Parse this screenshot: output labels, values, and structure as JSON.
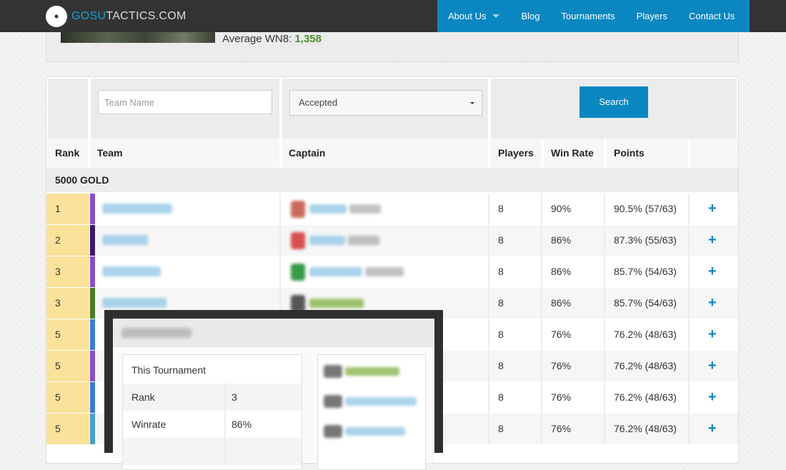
{
  "site": {
    "logo_accent": "GOSU",
    "logo_rest": "TACTICS.COM"
  },
  "nav": {
    "items": [
      {
        "label": "About Us",
        "has_dropdown": true
      },
      {
        "label": "Blog"
      },
      {
        "label": "Tournaments"
      },
      {
        "label": "Players"
      },
      {
        "label": "Contact Us"
      }
    ]
  },
  "summary": {
    "avg_wn8_label": "Average WN8:",
    "avg_wn8_value": "1,358"
  },
  "filters": {
    "team_placeholder": "Team Name",
    "status_value": "Accepted",
    "search_label": "Search"
  },
  "table": {
    "columns": {
      "rank": "Rank",
      "team": "Team",
      "captain": "Captain",
      "players": "Players",
      "win_rate": "Win Rate",
      "points": "Points"
    },
    "group_label": "5000 GOLD",
    "rows": [
      {
        "rank": "1",
        "players": "8",
        "win_rate": "90%",
        "points": "90.5% (57/63)",
        "plus": "+",
        "strip_color": "#8a4fc4",
        "avatar_color": "#c96a5c"
      },
      {
        "rank": "2",
        "players": "8",
        "win_rate": "86%",
        "points": "87.3% (55/63)",
        "plus": "+",
        "strip_color": "#3d1a66",
        "avatar_color": "#d65050"
      },
      {
        "rank": "3",
        "players": "8",
        "win_rate": "86%",
        "points": "85.7% (54/63)",
        "plus": "+",
        "strip_color": "#8a4fc4",
        "avatar_color": "#3a9a48"
      },
      {
        "rank": "3",
        "players": "8",
        "win_rate": "86%",
        "points": "85.7% (54/63)",
        "plus": "+",
        "strip_color": "#4a7a2c",
        "avatar_color": "#555555"
      },
      {
        "rank": "5",
        "players": "8",
        "win_rate": "76%",
        "points": "76.2% (48/63)",
        "plus": "+",
        "strip_color": "#3a7ccf",
        "avatar_color": "#777777"
      },
      {
        "rank": "5",
        "players": "8",
        "win_rate": "76%",
        "points": "76.2% (48/63)",
        "plus": "+",
        "strip_color": "#8a4fc4",
        "avatar_color": "#777777"
      },
      {
        "rank": "5",
        "players": "8",
        "win_rate": "76%",
        "points": "76.2% (48/63)",
        "plus": "+",
        "strip_color": "#3a7ccf",
        "avatar_color": "#777777"
      },
      {
        "rank": "5",
        "players": "8",
        "win_rate": "76%",
        "points": "76.2% (48/63)",
        "plus": "+",
        "strip_color": "#4aa0cc",
        "avatar_color": "#777777"
      }
    ]
  },
  "popup": {
    "stats": [
      {
        "label": "This Tournament",
        "value": ""
      },
      {
        "label": "Rank",
        "value": "3"
      },
      {
        "label": "Winrate",
        "value": "86%"
      }
    ]
  },
  "colors": {
    "nav_bg": "#333333",
    "accent_blue": "#0a87c0",
    "rank_yellow": "#fbe29a",
    "wn8_green": "#4a8a2c"
  }
}
